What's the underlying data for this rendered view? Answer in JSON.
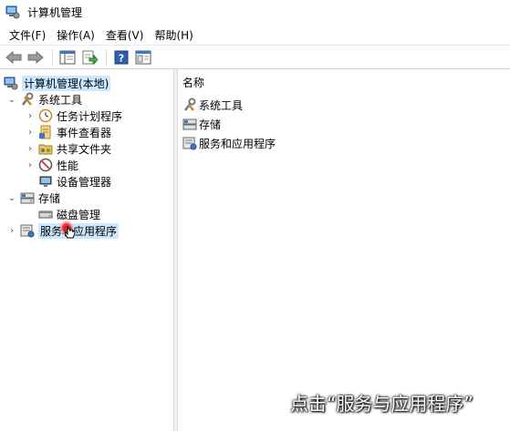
{
  "window": {
    "title": "计算机管理"
  },
  "menu": {
    "items": [
      "文件(F)",
      "操作(A)",
      "查看(V)",
      "帮助(H)"
    ]
  },
  "toolbar": {
    "buttons": [
      "back-icon",
      "forward-icon",
      "show-hide-tree-icon",
      "export-list-icon",
      "help-icon",
      "properties-icon"
    ]
  },
  "tree": {
    "root": "计算机管理(本地)",
    "system_tools": "系统工具",
    "task_scheduler": "任务计划程序",
    "event_viewer": "事件查看器",
    "shared_folders": "共享文件夹",
    "performance": "性能",
    "device_manager": "设备管理器",
    "storage": "存储",
    "disk_management": "磁盘管理",
    "services_apps": "服务和应用程序"
  },
  "list": {
    "header": "名称",
    "items": [
      "系统工具",
      "存储",
      "服务和应用程序"
    ]
  },
  "caption": "点击“服务与应用程序”",
  "colors": {
    "selection": "#cce8ff",
    "cursor": "#e02020"
  }
}
